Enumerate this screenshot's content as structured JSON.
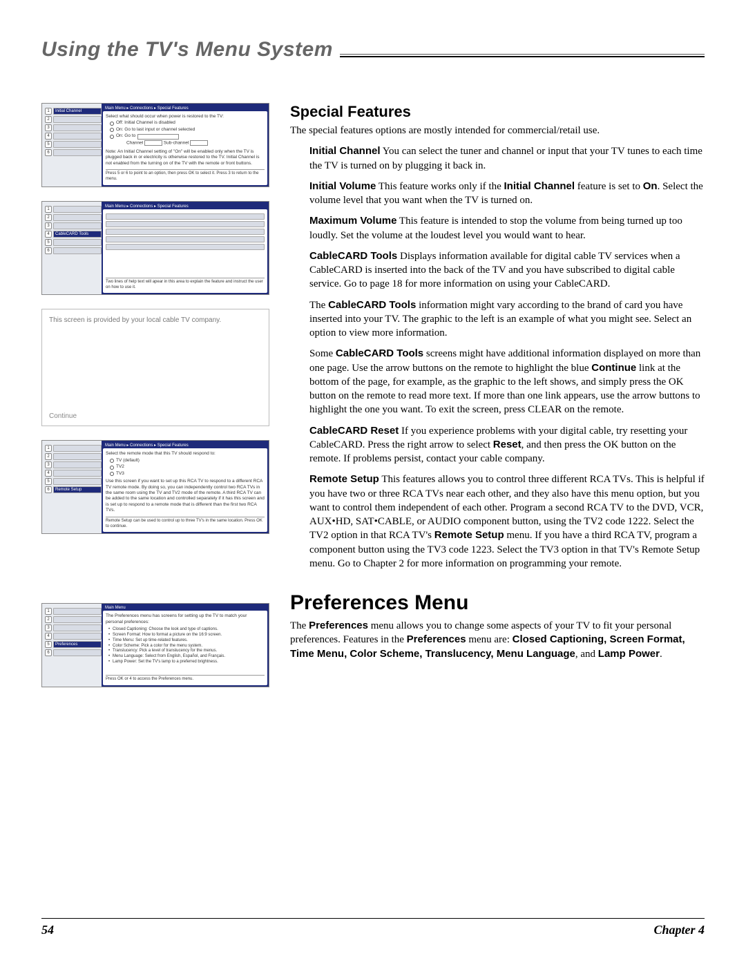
{
  "chapter_title": "Using the TV's Menu System",
  "special": {
    "heading": "Special Features",
    "intro": "The special features options are mostly intended for commercial/retail use.",
    "initial_channel_label": "Initial Channel",
    "initial_channel_text": "   You can select the tuner and channel or input that your TV tunes to each time the TV is turned on by plugging it back in.",
    "initial_volume_label": "Initial Volume",
    "initial_volume_text_a": "   This feature works only if the ",
    "initial_volume_text_b": " feature is set to ",
    "on_label": "On",
    "initial_volume_text_c": ". Select the volume level that you want when the TV is turned on.",
    "max_volume_label": "Maximum Volume",
    "max_volume_text": "   This feature is intended to stop the volume from being turned up too loudly. Set the volume at the loudest level you would want to hear.",
    "cc_tools_label": "CableCARD Tools",
    "cc_tools_text": "   Displays information available for digital cable TV services when a CableCARD is inserted into the back of the TV and you have subscribed to digital cable service. Go to page 18 for more information on using your CableCARD.",
    "cc_tools_note_a": "The ",
    "cc_tools_note_b": " information might vary according to the brand of card you have inserted into your TV. The graphic to the left is an example of what you might see. Select an option to view more information.",
    "cc_tools_some_a": "Some ",
    "cc_tools_some_b": " screens might have additional information displayed on more than one page. Use the arrow buttons on the remote to highlight the blue ",
    "continue_label": "Continue",
    "cc_tools_some_c": " link at the bottom of the page, for example, as the graphic to the left shows, and simply press the OK button on the remote to read more text. If more than one link appears, use the arrow buttons to highlight the one you want. To exit the screen, press CLEAR on the remote.",
    "cc_reset_label": "CableCARD Reset",
    "cc_reset_text_a": "   If you experience problems with your digital cable, try resetting your CableCARD. Press the right arrow to select ",
    "reset_label": "Reset",
    "cc_reset_text_b": ", and then press the OK button on the remote. If problems persist, contact your cable company.",
    "remote_setup_label": "Remote Setup",
    "remote_setup_text_a": "   This features allows you to control three different RCA TVs. This is helpful if you have two or three RCA TVs near each other, and they also have this menu option, but you want to control them independent of each other. Program a second RCA TV to the DVD, VCR, AUX•HD, SAT•CABLE, or AUDIO component button, using the TV2 code 1222. Select the TV2 option in that RCA TV's ",
    "remote_setup_text_b": " menu. If you have a third RCA TV, program a component button using the TV3 code 1223.  Select the TV3 option in that TV's Remote Setup menu. Go to Chapter 2 for more information on programming your remote."
  },
  "prefs": {
    "heading": "Preferences Menu",
    "text_a": "The ",
    "prefs_label": "Preferences",
    "text_b": " menu allows you to change some aspects of your TV to fit your personal preferences. Features in the ",
    "text_c": " menu are: ",
    "feat_list": "Closed Captioning, Screen Format, Time Menu, Color Scheme, Translucency, Menu Language",
    "text_d": ", and ",
    "lamp_label": "Lamp Power",
    "text_e": "."
  },
  "fig1": {
    "breadcrumb": "Main Menu ▸ Connections ▸ Special Features",
    "line1": "Select what should occur when power is restored to the TV:",
    "opt_off": "Off: Initial Channel is disabled",
    "opt_last": "On: Go to last input or channel selected",
    "opt_goto": "On: Go to",
    "ch": "Channel",
    "sub": "Sub-channel",
    "note": "Note: An Initial Channel setting of \"On\" will be enabled only when the TV is plugged back in or electricity is otherwise restored to the TV. Initial Channel is not enabled from the turning on of the TV with the remote or front buttons.",
    "help": "Press 5  or 6  to point to an option, then press OK to select it. Press 3  to return to the menu.",
    "tab_sel": "Initial Channel"
  },
  "fig2": {
    "breadcrumb": "Main Menu ▸ Connections ▸ Special Features",
    "help": "Two lines of help text will apear in this area to explain the feature and instruct the user on how to use it.",
    "tab_sel": "CableCARD Tools"
  },
  "fig3": {
    "provided": "This screen is provided by your local cable TV company.",
    "continue": "Continue"
  },
  "fig4": {
    "breadcrumb": "Main Menu ▸ Connections ▸ Special Features",
    "line1": "Select the remote mode that this TV should respond to:",
    "tv1": "TV (default)",
    "tv2": "TV2",
    "tv3": "TV3",
    "body": "Use this screen if you want to set up this RCA TV to respond to a different RCA TV remote mode. By doing so, you can independently control two RCA TVs in the same room using the TV and TV2 mode of the remote. A third RCA TV can be added to the same location and controlled separately if it has this screen and is set up to respond to a remote mode that is different than the first two RCA TVs.",
    "help": "Remote Setup can be used to control up to three TV's in the same location. Press OK to continue.",
    "tab_sel": "Remote Setup"
  },
  "fig5": {
    "breadcrumb": "Main Menu",
    "line1": "The Preferences menu has screens for setting up the TV to match your personal preferences:",
    "b1": "Closed Captioning: Choose the look and type of captions.",
    "b2": "Screen Format: How to format a picture on the 16:9 screen.",
    "b3": "Time Menu: Set up time-related features.",
    "b4": "Color Scheme: Pick a color for the menu system.",
    "b5": "Translucency: Pick a level of translucency for the menus.",
    "b6": "Menu Language: Select from English, Español, and Français.",
    "b7": "Lamp Power: Set the TV's lamp to a preferred brightness.",
    "help": "Press OK or 4  to access the Preferences menu.",
    "tab_sel": "Preferences"
  },
  "footer": {
    "page": "54",
    "chapter": "Chapter 4"
  }
}
